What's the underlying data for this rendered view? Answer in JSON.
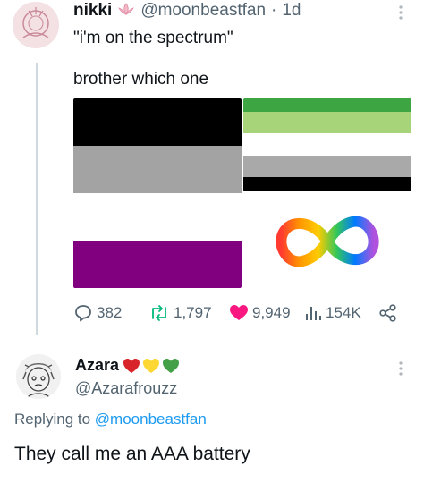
{
  "post": {
    "author_name": "nikki",
    "author_handle": "@moonbeastfan",
    "separator": "·",
    "time": "1d",
    "text_line1": "\"i'm on the spectrum\"",
    "text_line2": "brother which one",
    "stats": {
      "replies": "382",
      "reposts": "1,797",
      "likes": "9,949",
      "views": "154K"
    }
  },
  "reply": {
    "author_name": "Azara",
    "author_handle": "@Azarafrouzz",
    "replying_prefix": "Replying to",
    "replying_to": "@moonbeastfan",
    "text": "They call me an AAA battery"
  },
  "flags": {
    "asexual": [
      "#000000",
      "#a3a3a3",
      "#ffffff",
      "#800080"
    ],
    "aromantic": [
      "#3da542",
      "#a7d379",
      "#ffffff",
      "#a9a9a9",
      "#000000"
    ]
  },
  "colors": {
    "like": "#f91880",
    "repost": "#00ba7c",
    "link": "#1d9bf0",
    "muted": "#536471"
  }
}
